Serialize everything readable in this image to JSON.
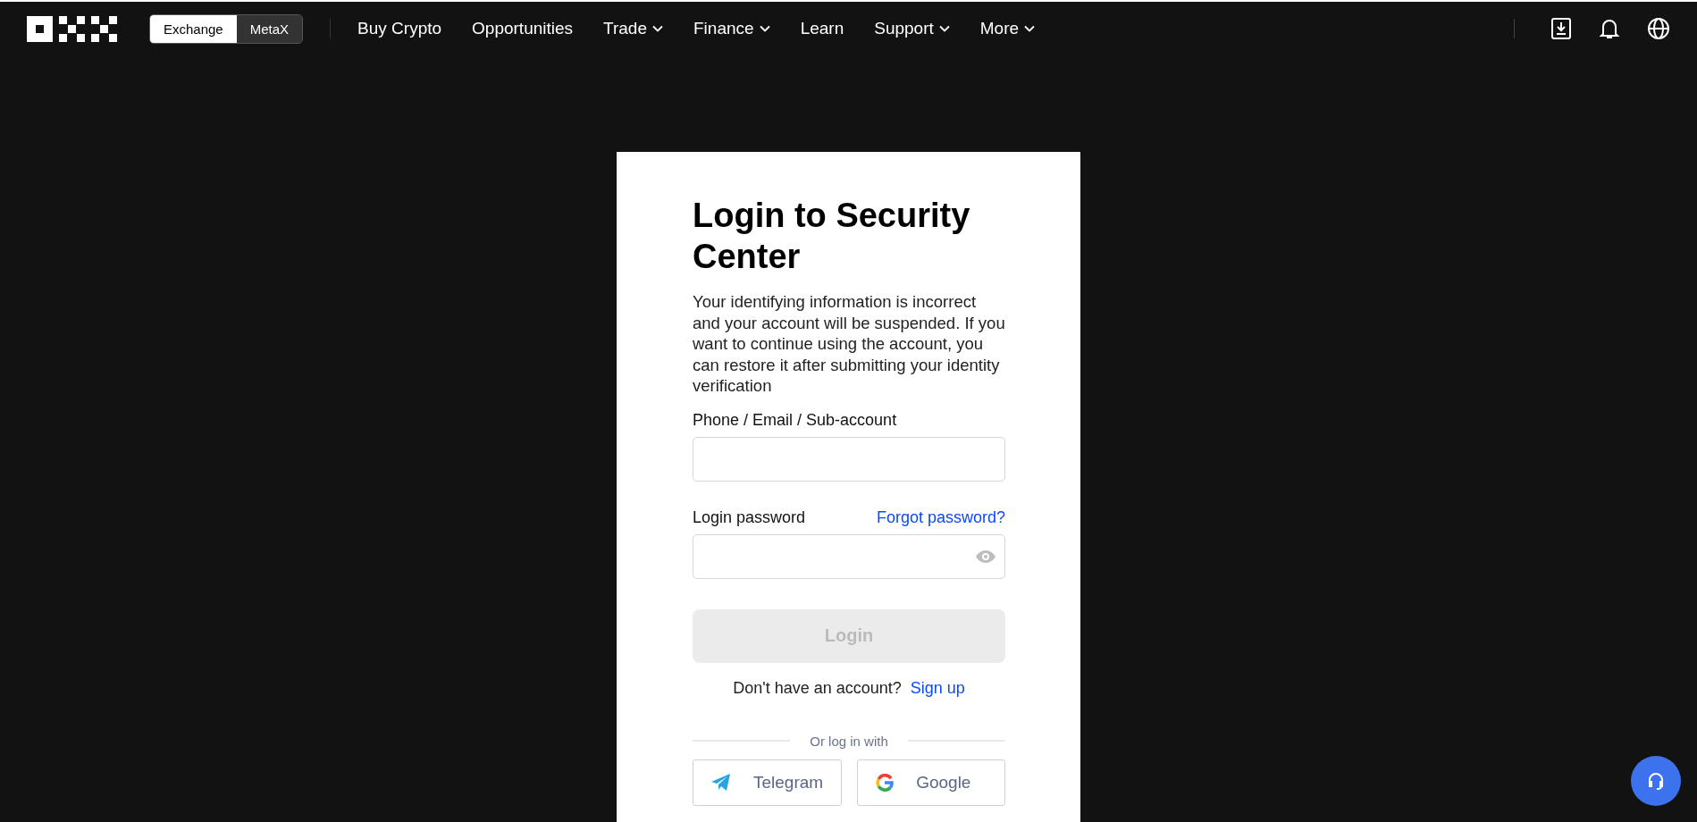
{
  "header": {
    "mode_switch": [
      {
        "label": "Exchange",
        "selected": true
      },
      {
        "label": "MetaX",
        "selected": false
      }
    ],
    "nav": [
      {
        "label": "Buy Crypto",
        "has_menu": false
      },
      {
        "label": "Opportunities",
        "has_menu": false
      },
      {
        "label": "Trade",
        "has_menu": true
      },
      {
        "label": "Finance",
        "has_menu": true
      },
      {
        "label": "Learn",
        "has_menu": false
      },
      {
        "label": "Support",
        "has_menu": true
      },
      {
        "label": "More",
        "has_menu": true
      }
    ]
  },
  "login": {
    "title": "Login to Security Center",
    "message": "Your identifying information is incorrect and your account will be suspended. If you want to continue using the account, you can restore it after submitting your identity verification",
    "fields": [
      {
        "label": "Phone / Email / Sub-account",
        "kind": "text"
      },
      {
        "label": "Login password",
        "kind": "password",
        "link": "Forgot password?"
      }
    ],
    "submit": {
      "label": "Login",
      "disabled": true
    },
    "signup_prompt": "Don't have an account?",
    "signup_link": "Sign up",
    "divider": "Or log in with",
    "social": [
      {
        "label": "Telegram",
        "kind": "telegram"
      },
      {
        "label": "Google",
        "kind": "google"
      }
    ]
  }
}
